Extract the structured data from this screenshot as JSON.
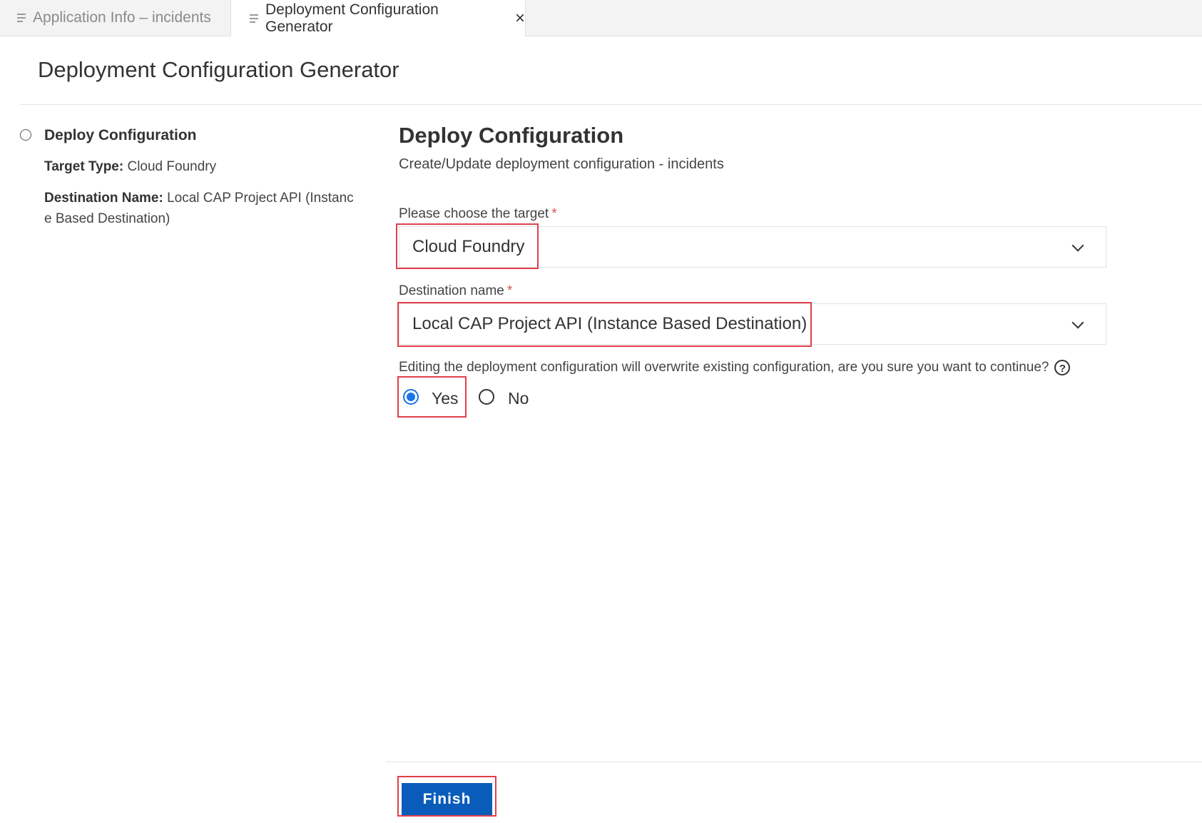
{
  "tabs": [
    {
      "label": "Application Info – incidents",
      "active": false
    },
    {
      "label": "Deployment Configuration Generator",
      "active": true
    }
  ],
  "page_title": "Deployment Configuration Generator",
  "steps_panel": {
    "title": "Deploy Configuration",
    "target_type_label": "Target Type:",
    "target_type_value": "Cloud Foundry",
    "destination_label": "Destination Name:",
    "destination_value": "Local CAP Project API (Instance Based Destination)"
  },
  "form": {
    "title": "Deploy Configuration",
    "subtitle": "Create/Update deployment configuration - incidents",
    "target_label": "Please choose the target",
    "target_value": "Cloud Foundry",
    "destination_label": "Destination name",
    "destination_value": "Local CAP Project API (Instance Based Destination)",
    "required_mark": "*",
    "overwrite_question": "Editing the deployment configuration will overwrite existing configuration, are you sure you want to continue?",
    "help_glyph": "?",
    "yes_label": "Yes",
    "no_label": "No",
    "selected_option": "Yes"
  },
  "finish_label": "Finish",
  "colors": {
    "accent": "#1a73e8",
    "button": "#0a5cba",
    "highlight": "#e0414b",
    "required": "#d9534f"
  }
}
